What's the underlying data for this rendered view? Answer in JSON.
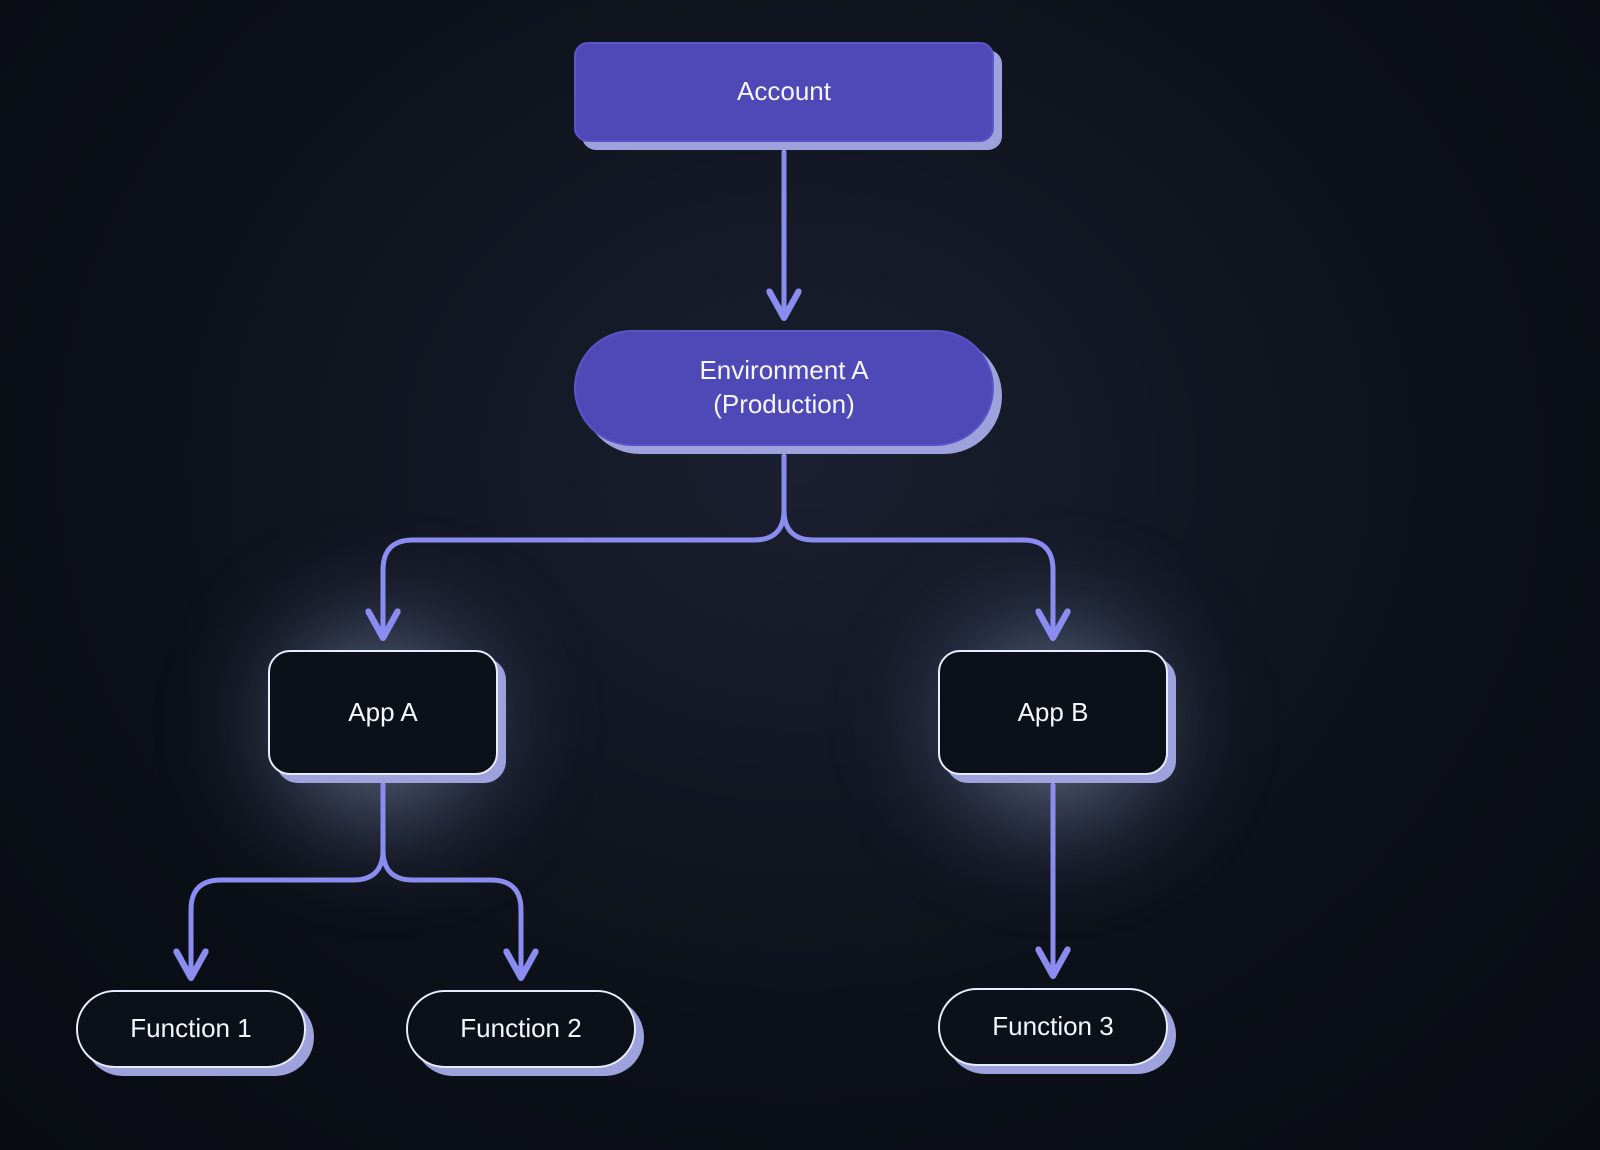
{
  "diagram": {
    "account": {
      "label": "Account"
    },
    "environment": {
      "line1": "Environment A",
      "line2": "(Production)"
    },
    "apps": {
      "a": {
        "label": "App A"
      },
      "b": {
        "label": "App B"
      }
    },
    "functions": {
      "f1": {
        "label": "Function 1"
      },
      "f2": {
        "label": "Function 2"
      },
      "f3": {
        "label": "Function 3"
      }
    },
    "colors": {
      "node_fill": "#4f48b7",
      "shadow": "#9ea2dc",
      "outline": "#e8ecff",
      "connector": "#8a8cf0",
      "bg": "#0c1018"
    }
  }
}
